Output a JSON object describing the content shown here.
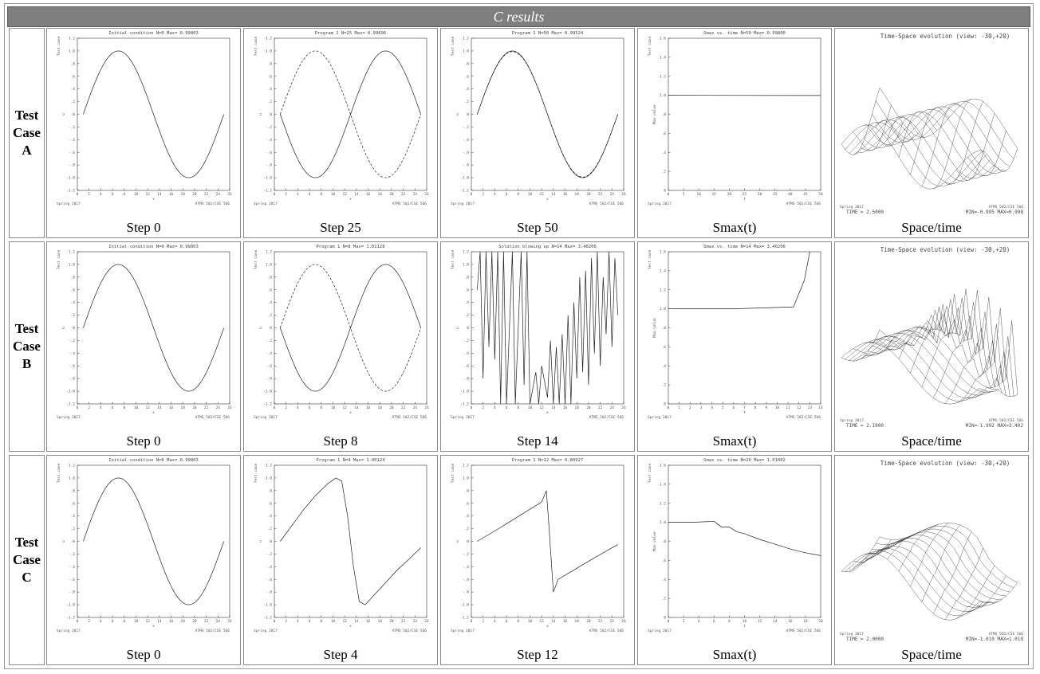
{
  "header": {
    "title": "C results"
  },
  "rows": [
    {
      "label": [
        "Test",
        "Case",
        "A"
      ]
    },
    {
      "label": [
        "Test",
        "Case",
        "B"
      ]
    },
    {
      "label": [
        "Test",
        "Case",
        "C"
      ]
    }
  ],
  "footer_text": {
    "left": "Spring 2017",
    "right": "ATMS 502/CSE 566",
    "x_axis": "x",
    "y_axis_u": "u",
    "y_axis_max": "Max value",
    "y_axis_top": "Test case"
  },
  "chart_data": [
    {
      "type": "line",
      "caption": "Step 0",
      "title": "Initial condition  N=0 Max= 0.99803",
      "xlim": [
        0,
        26
      ],
      "ylim": [
        -1.2,
        1.2
      ],
      "x_ticks": [
        "0",
        "2",
        "4",
        "6",
        "8",
        "10",
        "12",
        "14",
        "16",
        "18",
        "20",
        "22",
        "24",
        "26"
      ],
      "y_ticks": [
        "-1.2",
        "-1.0",
        "-.8",
        "-.6",
        "-.4",
        "-.2",
        "0",
        ".2",
        ".4",
        ".6",
        ".8",
        "1.0",
        "1.2"
      ],
      "series": [
        {
          "style": "solid",
          "fn": "sine",
          "x_range": [
            1,
            25
          ]
        }
      ]
    },
    {
      "type": "line",
      "caption": "Step 25",
      "title": "Program 1  N=25 Max= 0.99696",
      "xlim": [
        0,
        26
      ],
      "ylim": [
        -1.2,
        1.2
      ],
      "x_ticks": [
        "0",
        "2",
        "4",
        "6",
        "8",
        "10",
        "12",
        "14",
        "16",
        "18",
        "20",
        "22",
        "24",
        "26"
      ],
      "y_ticks": [
        "-1.2",
        "-1.0",
        "-.8",
        "-.6",
        "-.4",
        "-.2",
        "0",
        ".2",
        ".4",
        ".6",
        ".8",
        "1.0",
        "1.2"
      ],
      "series": [
        {
          "style": "solid",
          "fn": "sine",
          "x_range": [
            1,
            25
          ],
          "scale": -1
        },
        {
          "style": "dashed",
          "fn": "sine",
          "x_range": [
            1,
            25
          ]
        }
      ]
    },
    {
      "type": "line",
      "caption": "Step 50",
      "title": "Program 1  N=50 Max= 0.99524",
      "xlim": [
        0,
        26
      ],
      "ylim": [
        -1.2,
        1.2
      ],
      "x_ticks": [
        "0",
        "2",
        "4",
        "6",
        "8",
        "10",
        "12",
        "14",
        "16",
        "18",
        "20",
        "22",
        "24",
        "26"
      ],
      "y_ticks": [
        "-1.2",
        "-1.0",
        "-.8",
        "-.6",
        "-.4",
        "-.2",
        "0",
        ".2",
        ".4",
        ".6",
        ".8",
        "1.0",
        "1.2"
      ],
      "series": [
        {
          "style": "solid",
          "fn": "sine",
          "x_range": [
            1,
            25
          ]
        },
        {
          "style": "dashed",
          "fn": "sine",
          "x_range": [
            1,
            25
          ],
          "scale": 0.99
        }
      ]
    },
    {
      "type": "line",
      "caption": "Smax(t)",
      "title": "Smax vs. time  N=50 Max= 0.99800",
      "xlim": [
        0,
        50
      ],
      "ylim": [
        0,
        1.6
      ],
      "x_ticks": [
        "0",
        "5",
        "10",
        "15",
        "20",
        "25",
        "30",
        "35",
        "40",
        "45",
        "50"
      ],
      "y_ticks": [
        "0",
        ".2",
        ".4",
        ".6",
        ".8",
        "1.0",
        "1.2",
        "1.4",
        "1.6"
      ],
      "series": [
        {
          "style": "solid",
          "points": [
            [
              0,
              1.0
            ],
            [
              50,
              0.998
            ]
          ]
        }
      ]
    },
    {
      "type": "surface",
      "caption": "Space/time",
      "title": "Time-Space evolution (view: -30,+20)",
      "time_text": "TIME = 2.5000",
      "minmax_text": "MIN=-0.995  MAX=0.998",
      "variant": "A"
    },
    {
      "type": "line",
      "caption": "Step 0",
      "title": "Initial condition  N=0 Max= 0.99803",
      "xlim": [
        0,
        26
      ],
      "ylim": [
        -1.2,
        1.2
      ],
      "x_ticks": [
        "0",
        "2",
        "4",
        "6",
        "8",
        "10",
        "12",
        "14",
        "16",
        "18",
        "20",
        "22",
        "24",
        "26"
      ],
      "y_ticks": [
        "-1.2",
        "-1.0",
        "-.8",
        "-.6",
        "-.4",
        "-.2",
        "0",
        ".2",
        ".4",
        ".6",
        ".8",
        "1.0",
        "1.2"
      ],
      "series": [
        {
          "style": "solid",
          "fn": "sine",
          "x_range": [
            1,
            25
          ]
        }
      ]
    },
    {
      "type": "line",
      "caption": "Step 8",
      "title": "Program 1  N=8 Max= 1.01128",
      "xlim": [
        0,
        26
      ],
      "ylim": [
        -1.2,
        1.2
      ],
      "x_ticks": [
        "0",
        "2",
        "4",
        "6",
        "8",
        "10",
        "12",
        "14",
        "16",
        "18",
        "20",
        "22",
        "24",
        "26"
      ],
      "y_ticks": [
        "-1.2",
        "-1.0",
        "-.8",
        "-.6",
        "-.4",
        "-.2",
        "0",
        ".2",
        ".4",
        ".6",
        ".8",
        "1.0",
        "1.2"
      ],
      "series": [
        {
          "style": "solid",
          "fn": "sine",
          "x_range": [
            1,
            25
          ],
          "scale": -1
        },
        {
          "style": "dashed",
          "fn": "sine",
          "x_range": [
            1,
            25
          ]
        }
      ]
    },
    {
      "type": "line",
      "caption": "Step 14",
      "title": "Solution blowing up  N=14 Max= 3.40206",
      "xlim": [
        0,
        26
      ],
      "ylim": [
        -1.2,
        1.2
      ],
      "x_ticks": [
        "0",
        "2",
        "4",
        "6",
        "8",
        "10",
        "12",
        "14",
        "16",
        "18",
        "20",
        "22",
        "24",
        "26"
      ],
      "y_ticks": [
        "-1.2",
        "-1.0",
        "-.8",
        "-.6",
        "-.4",
        "-.2",
        "0",
        ".2",
        ".4",
        ".6",
        ".8",
        "1.0",
        "1.2"
      ],
      "series": [
        {
          "style": "solid",
          "points": [
            [
              1,
              0.6
            ],
            [
              1.5,
              1.2
            ],
            [
              2,
              -0.8
            ],
            [
              2.5,
              1.2
            ],
            [
              3,
              -0.3
            ],
            [
              3.5,
              1.2
            ],
            [
              4,
              -0.5
            ],
            [
              4.5,
              1.2
            ],
            [
              5,
              -1.2
            ],
            [
              5.5,
              1.2
            ],
            [
              6,
              -1.2
            ],
            [
              7,
              1.2
            ],
            [
              7.5,
              -1.2
            ],
            [
              8.5,
              1.2
            ],
            [
              9,
              -0.9
            ],
            [
              9.5,
              1.2
            ],
            [
              10,
              -1.2
            ],
            [
              11,
              -0.7
            ],
            [
              11.5,
              -1.2
            ],
            [
              12,
              -0.6
            ],
            [
              13,
              -1.1
            ],
            [
              13.5,
              -0.2
            ],
            [
              14,
              -1.2
            ],
            [
              14.5,
              -0.3
            ],
            [
              15,
              -1.2
            ],
            [
              15.5,
              -0.1
            ],
            [
              16,
              -1.2
            ],
            [
              16.5,
              0.2
            ],
            [
              17,
              -1.2
            ],
            [
              17.5,
              0.4
            ],
            [
              18,
              -0.8
            ],
            [
              18.5,
              0.8
            ],
            [
              19,
              -0.7
            ],
            [
              19.5,
              0.9
            ],
            [
              20,
              -0.9
            ],
            [
              20.5,
              1.1
            ],
            [
              21,
              -0.4
            ],
            [
              21.5,
              1.2
            ],
            [
              22,
              -0.6
            ],
            [
              22.5,
              0.8
            ],
            [
              23,
              -0.1
            ],
            [
              23.5,
              1.2
            ],
            [
              24,
              -0.3
            ],
            [
              24.5,
              1.1
            ],
            [
              25,
              0.2
            ]
          ]
        }
      ]
    },
    {
      "type": "line",
      "caption": "Smax(t)",
      "title": "Smax vs. time  N=14 Max= 3.40206",
      "xlim": [
        0,
        14
      ],
      "ylim": [
        0,
        1.6
      ],
      "x_ticks": [
        "0",
        "1",
        "2",
        "3",
        "4",
        "5",
        "6",
        "7",
        "8",
        "9",
        "10",
        "11",
        "12",
        "13",
        "14"
      ],
      "y_ticks": [
        "0",
        ".2",
        ".4",
        ".6",
        ".8",
        "1.0",
        "1.2",
        "1.4",
        "1.6"
      ],
      "series": [
        {
          "style": "solid",
          "points": [
            [
              0,
              1.0
            ],
            [
              6,
              1.0
            ],
            [
              11.5,
              1.02
            ],
            [
              12.5,
              1.3
            ],
            [
              13,
              1.6
            ]
          ]
        }
      ]
    },
    {
      "type": "surface",
      "caption": "Space/time",
      "title": "Time-Space evolution (view: -30,+20)",
      "time_text": "TIME = 2.1000",
      "minmax_text": "MIN=-1.992  MAX=3.402",
      "variant": "B"
    },
    {
      "type": "line",
      "caption": "Step 0",
      "title": "Initial condition  N=0 Max= 0.99803",
      "xlim": [
        0,
        26
      ],
      "ylim": [
        -1.2,
        1.2
      ],
      "x_ticks": [
        "0",
        "2",
        "4",
        "6",
        "8",
        "10",
        "12",
        "14",
        "16",
        "18",
        "20",
        "22",
        "24",
        "26"
      ],
      "y_ticks": [
        "-1.2",
        "-1.0",
        "-.8",
        "-.6",
        "-.4",
        "-.2",
        "0",
        ".2",
        ".4",
        ".6",
        ".8",
        "1.0",
        "1.2"
      ],
      "series": [
        {
          "style": "solid",
          "fn": "sine",
          "x_range": [
            1,
            25
          ]
        }
      ]
    },
    {
      "type": "line",
      "caption": "Step 4",
      "title": "Program 1  N=4 Max= 1.00124",
      "xlim": [
        0,
        26
      ],
      "ylim": [
        -1.2,
        1.2
      ],
      "x_ticks": [
        "0",
        "2",
        "4",
        "6",
        "8",
        "10",
        "12",
        "14",
        "16",
        "18",
        "20",
        "22",
        "24",
        "26"
      ],
      "y_ticks": [
        "-1.2",
        "-1.0",
        "-.8",
        "-.6",
        "-.4",
        "-.2",
        "0",
        ".2",
        ".4",
        ".6",
        ".8",
        "1.0",
        "1.2"
      ],
      "series": [
        {
          "style": "solid",
          "points": [
            [
              1,
              0
            ],
            [
              3,
              0.25
            ],
            [
              5,
              0.5
            ],
            [
              7,
              0.72
            ],
            [
              9,
              0.9
            ],
            [
              10.5,
              1.0
            ],
            [
              11.5,
              0.95
            ],
            [
              12.5,
              0.4
            ],
            [
              13.5,
              -0.4
            ],
            [
              14.5,
              -0.95
            ],
            [
              15.5,
              -1.0
            ],
            [
              17,
              -0.85
            ],
            [
              19,
              -0.65
            ],
            [
              21,
              -0.45
            ],
            [
              23,
              -0.28
            ],
            [
              25,
              -0.1
            ]
          ]
        }
      ]
    },
    {
      "type": "line",
      "caption": "Step 12",
      "title": "Program 1  N=12 Max= 0.80927",
      "xlim": [
        0,
        26
      ],
      "ylim": [
        -1.2,
        1.2
      ],
      "x_ticks": [
        "0",
        "2",
        "4",
        "6",
        "8",
        "10",
        "12",
        "14",
        "16",
        "18",
        "20",
        "22",
        "24",
        "26"
      ],
      "y_ticks": [
        "-1.2",
        "-1.0",
        "-.8",
        "-.6",
        "-.4",
        "-.2",
        "0",
        ".2",
        ".4",
        ".6",
        ".8",
        "1.0",
        "1.2"
      ],
      "series": [
        {
          "style": "solid",
          "points": [
            [
              1,
              0
            ],
            [
              5,
              0.22
            ],
            [
              9,
              0.45
            ],
            [
              12,
              0.62
            ],
            [
              12.8,
              0.8
            ],
            [
              13.2,
              0.3
            ],
            [
              14,
              -0.8
            ],
            [
              14.8,
              -0.6
            ],
            [
              17,
              -0.48
            ],
            [
              21,
              -0.26
            ],
            [
              25,
              -0.05
            ]
          ]
        }
      ]
    },
    {
      "type": "line",
      "caption": "Smax(t)",
      "title": "Smax vs. time  N=20 Max= 1.01002",
      "xlim": [
        0,
        20
      ],
      "ylim": [
        0,
        1.6
      ],
      "x_ticks": [
        "0",
        "2",
        "4",
        "6",
        "8",
        "10",
        "12",
        "14",
        "16",
        "18",
        "20"
      ],
      "y_ticks": [
        "0",
        ".2",
        ".4",
        ".6",
        ".8",
        "1.0",
        "1.2",
        "1.4",
        "1.6"
      ],
      "series": [
        {
          "style": "solid",
          "points": [
            [
              0,
              1.0
            ],
            [
              3,
              1.0
            ],
            [
              6,
              1.01
            ],
            [
              7,
              0.95
            ],
            [
              8,
              0.95
            ],
            [
              9,
              0.9
            ],
            [
              10,
              0.88
            ],
            [
              12,
              0.82
            ],
            [
              14,
              0.77
            ],
            [
              16,
              0.72
            ],
            [
              18,
              0.68
            ],
            [
              20,
              0.65
            ]
          ]
        }
      ]
    },
    {
      "type": "surface",
      "caption": "Space/time",
      "title": "Time-Space evolution (view: -30,+20)",
      "time_text": "TIME = 2.0000",
      "minmax_text": "MIN=-1.010  MAX=1.010",
      "variant": "C"
    }
  ]
}
